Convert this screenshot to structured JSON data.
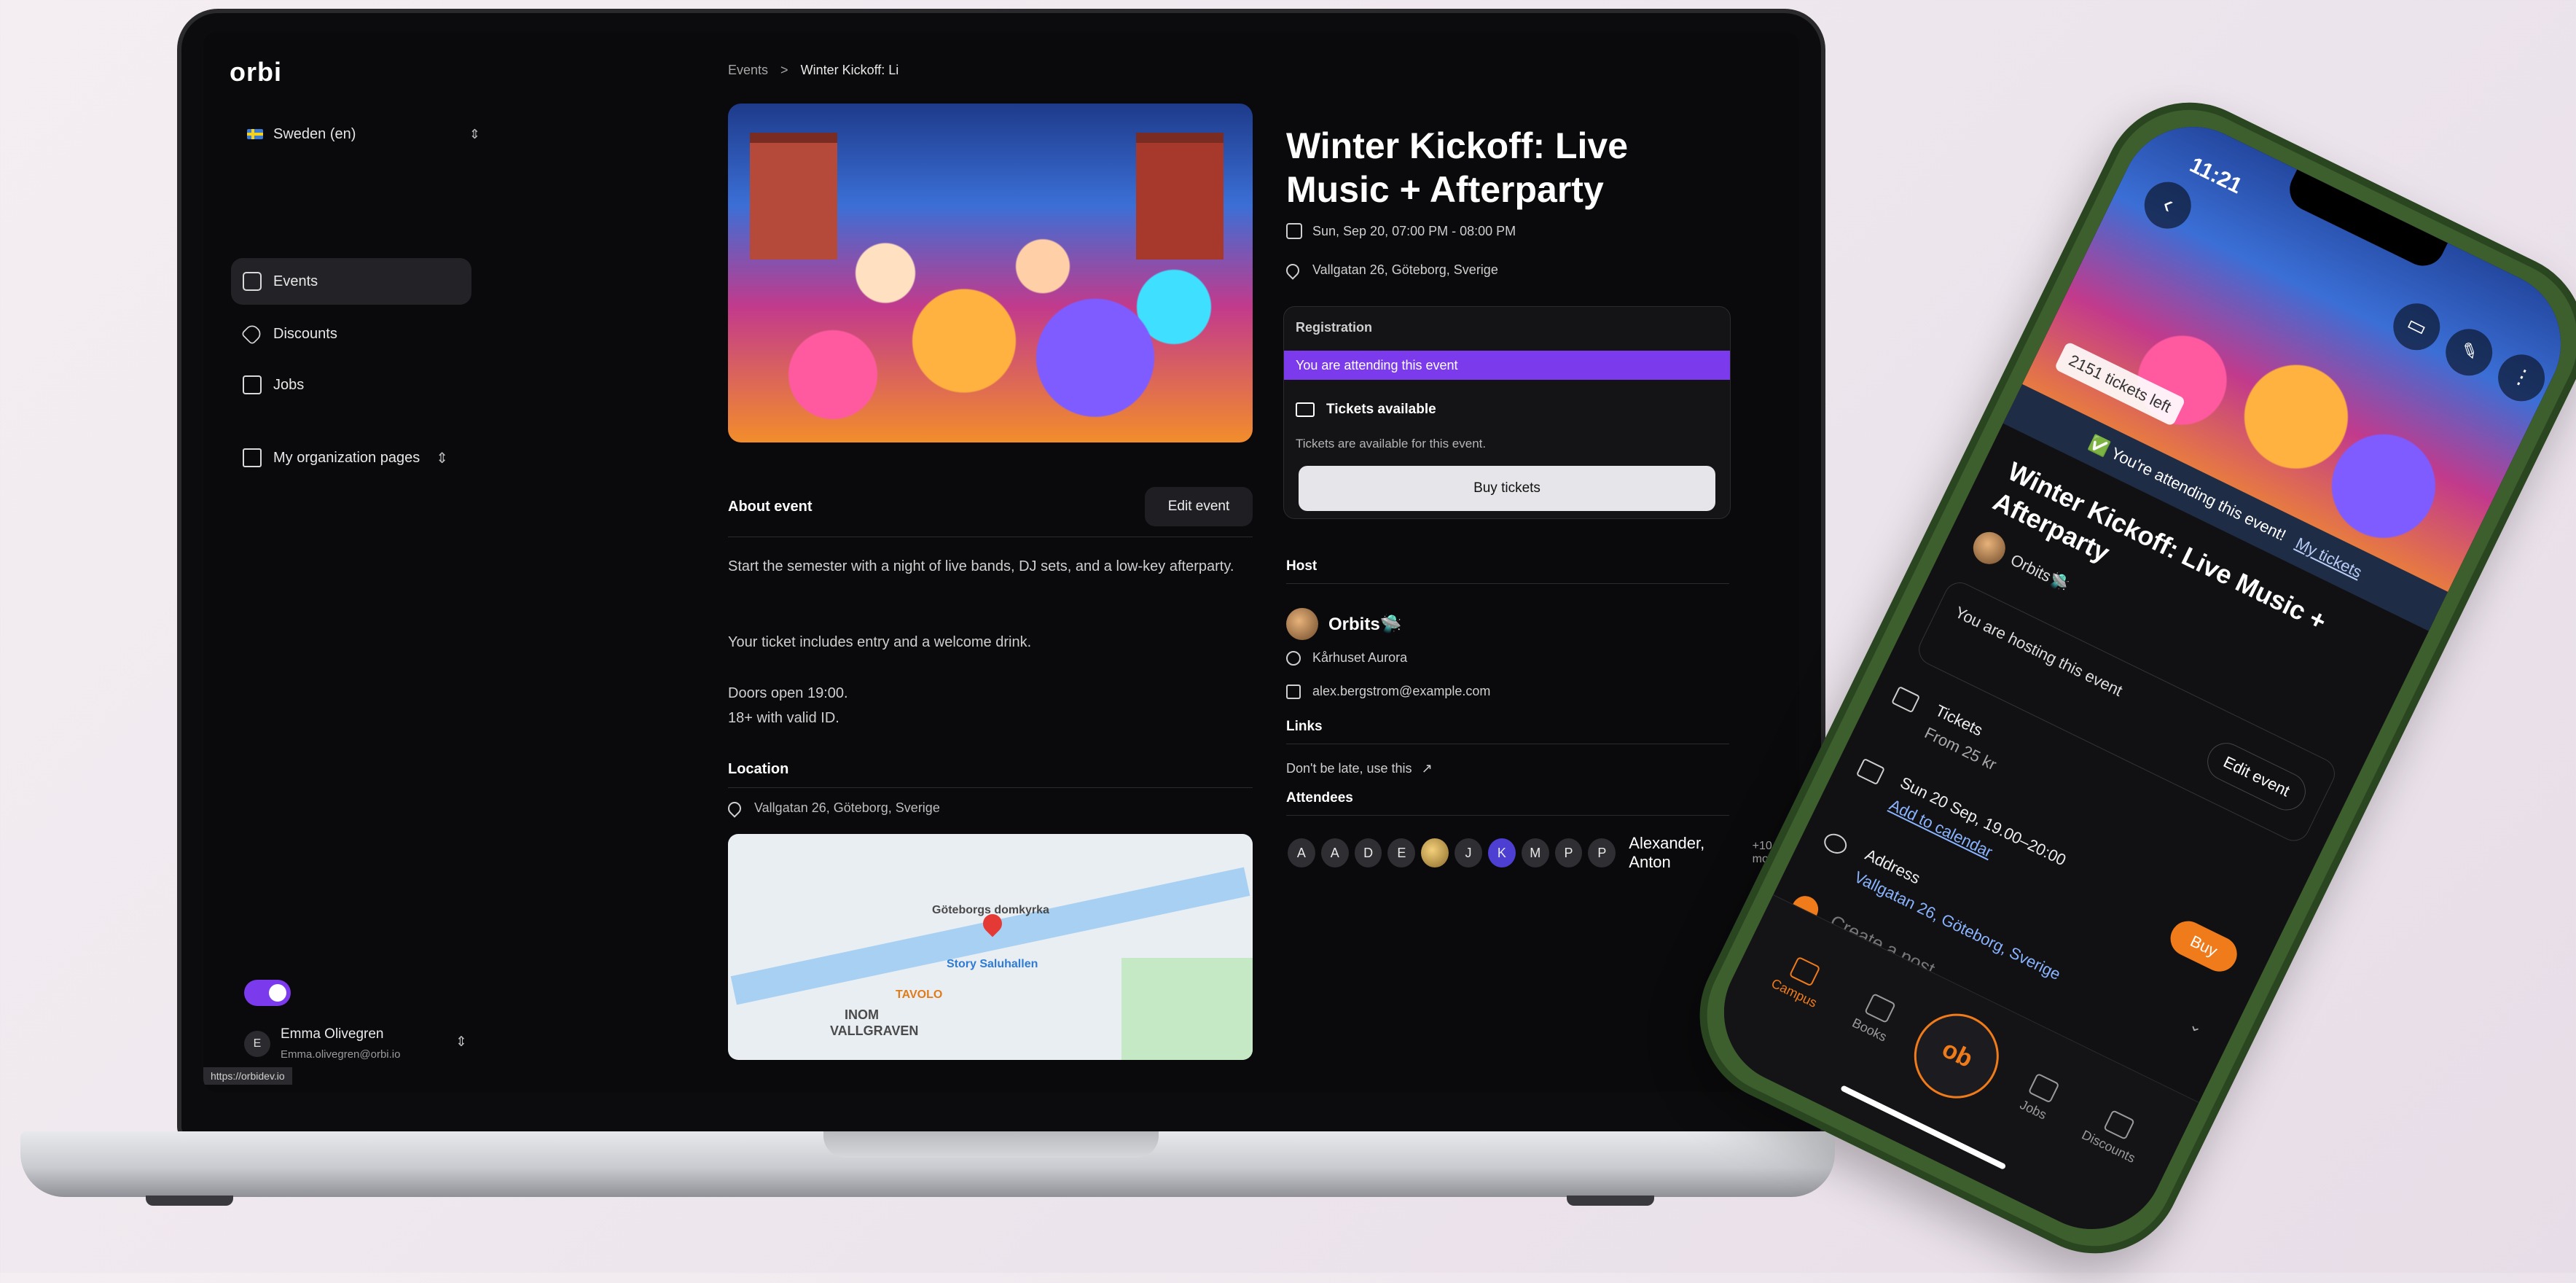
{
  "laptop": {
    "logo": "orbi",
    "country": "Sweden (en)",
    "nav": [
      {
        "label": "Events",
        "active": true
      },
      {
        "label": "Discounts",
        "active": false
      },
      {
        "label": "Jobs",
        "active": false
      }
    ],
    "org_pages": "My organization pages",
    "user": {
      "initial": "E",
      "name": "Emma Olivegren",
      "email": "Emma.olivegren@orbi.io"
    },
    "url_tip": "https://orbidev.io",
    "breadcrumb": {
      "root": "Events",
      "sep": ">",
      "current": "Winter Kickoff: Li"
    },
    "about": {
      "title": "About event",
      "edit": "Edit event",
      "p1": "Start the semester with a night of live bands, DJ sets, and a low-key afterparty.",
      "p2": "Your ticket includes entry and a welcome drink.",
      "p3a": "Doors open 19:00.",
      "p3b": "18+ with valid ID."
    },
    "location": {
      "title": "Location",
      "address": "Vallgatan 26, Göteborg, Sverige",
      "map_labels": {
        "district": "INOM",
        "district2": "VALLGRAVEN",
        "poi1": "Story Saluhallen",
        "poi2": "Göteborgs domkyrka",
        "poi3": "TAVOLO"
      }
    },
    "event": {
      "title": "Winter Kickoff: Live Music + Afterparty",
      "datetime": "Sun, Sep 20, 07:00 PM - 08:00 PM",
      "address": "Vallgatan 26, Göteborg, Sverige"
    },
    "registration": {
      "header": "Registration",
      "bar": "You are attending this event",
      "tickets_title": "Tickets available",
      "tickets_desc": "Tickets are available for this event.",
      "buy": "Buy tickets"
    },
    "host": {
      "title": "Host",
      "name": "Orbits🛸",
      "venue": "Kårhuset Aurora",
      "email": "alex.bergstrom@example.com"
    },
    "links": {
      "title": "Links",
      "text": "Don't be late, use this"
    },
    "attendees": {
      "title": "Attendees",
      "initials": [
        "A",
        "A",
        "D",
        "E",
        "",
        "J",
        "K",
        "M",
        "P",
        "P"
      ],
      "names": "Alexander, Anton",
      "more": "+10 more"
    }
  },
  "phone": {
    "time": "11:21",
    "tickets_left": "2151 tickets left",
    "attending": "✅ You're attending this event!",
    "my_tickets": "My tickets",
    "title": "Winter Kickoff: Live Music + Afterparty",
    "host": "Orbits🛸",
    "hosting_text": "You are hosting this event",
    "edit": "Edit event",
    "tickets_label": "Tickets",
    "tickets_price": "From 25 kr",
    "buy": "Buy",
    "date": "Sun 20 Sep, 19.00–20:00",
    "add_calendar": "Add to calendar",
    "address_label": "Address",
    "address": "Vallgatan 26, Göteborg, Sverige",
    "create_post": "Create a post",
    "tabs": [
      "Campus",
      "Books",
      "Jobs",
      "Discounts"
    ],
    "center_logo": "ob"
  }
}
